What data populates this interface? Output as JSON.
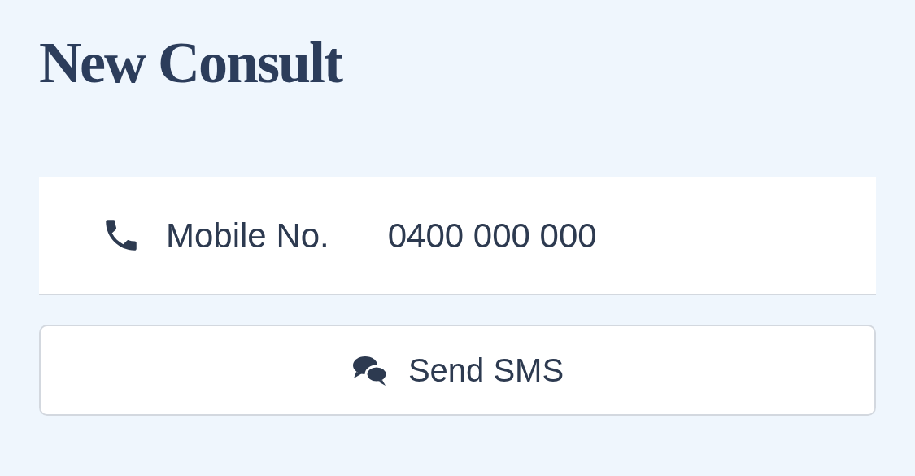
{
  "title": "New Consult",
  "mobile": {
    "label": "Mobile No.",
    "value": "0400 000 000"
  },
  "button": {
    "label": "Send SMS"
  }
}
